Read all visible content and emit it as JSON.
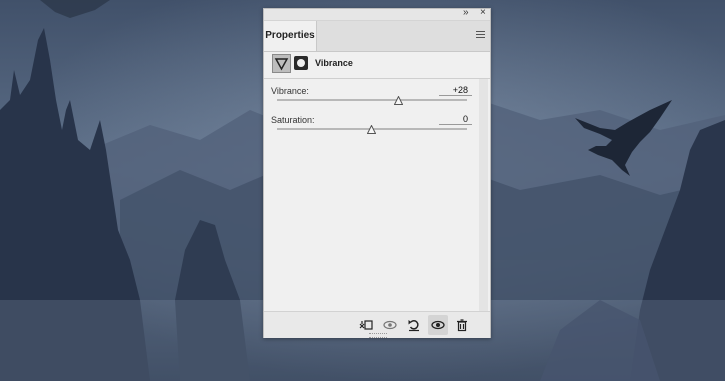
{
  "panel": {
    "tab_label": "Properties",
    "adjustment_title": "Vibrance",
    "vibrance": {
      "label": "Vibrance:",
      "value": "+28",
      "position": 0.64
    },
    "saturation": {
      "label": "Saturation:",
      "value": "0",
      "position": 0.5
    }
  },
  "icons": {
    "collapse": "double-chevron-icon",
    "close": "close-icon",
    "menu": "hamburger-menu-icon",
    "adjustment": "vibrance-triangle-icon",
    "mask": "layer-mask-icon",
    "clip": "clip-to-layer-icon",
    "view_previous": "view-previous-state-icon",
    "reset": "reset-adjustments-icon",
    "visibility": "visibility-eye-icon",
    "delete": "trash-icon"
  }
}
